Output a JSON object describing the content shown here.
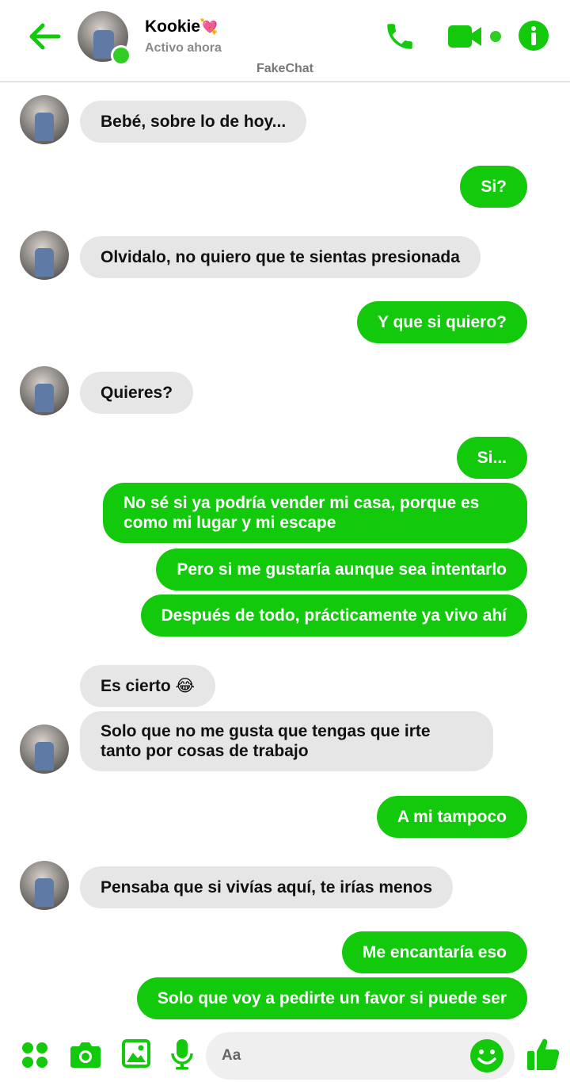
{
  "header": {
    "contact_name": "Kookie",
    "contact_emoji": "💘",
    "status": "Activo ahora",
    "watermark": "FakeChat",
    "accent": "#12c90c",
    "online_color": "#31cc24"
  },
  "messages": [
    {
      "from": "contact",
      "text": "Bebé, sobre lo de hoy...",
      "avatar": true
    },
    {
      "from": "me",
      "text": "Si?"
    },
    {
      "from": "contact",
      "text": "Olvidalo, no quiero que te sientas presionada",
      "avatar": true
    },
    {
      "from": "me",
      "text": "Y que si quiero?"
    },
    {
      "from": "contact",
      "text": "Quieres?",
      "avatar": true
    },
    {
      "from": "me",
      "text": "Si..."
    },
    {
      "from": "me",
      "text": "No sé si ya podría vender mi casa, porque es como mi lugar y mi escape"
    },
    {
      "from": "me",
      "text": "Pero si me gustaría aunque sea intentarlo"
    },
    {
      "from": "me",
      "text": "Después de todo, prácticamente ya vivo ahí"
    },
    {
      "from": "contact",
      "text": "Es cierto 😂",
      "avatar": false
    },
    {
      "from": "contact",
      "text": "Solo que no me gusta que tengas que irte tanto por cosas de trabajo",
      "avatar": true
    },
    {
      "from": "me",
      "text": "A mi tampoco"
    },
    {
      "from": "contact",
      "text": "Pensaba que si vivías aquí, te irías menos",
      "avatar": true
    },
    {
      "from": "me",
      "text": "Me encantaría eso"
    },
    {
      "from": "me",
      "text": "Solo que voy a pedirte un favor si puede ser"
    }
  ],
  "composer": {
    "placeholder": "Aa"
  },
  "icons": {
    "back": "arrow-left-icon",
    "call": "phone-icon",
    "video": "video-camera-icon",
    "info": "info-icon",
    "apps": "apps-grid-icon",
    "camera": "camera-icon",
    "gallery": "image-icon",
    "mic": "microphone-icon",
    "emoji": "smiley-icon",
    "like": "thumbs-up-icon"
  }
}
